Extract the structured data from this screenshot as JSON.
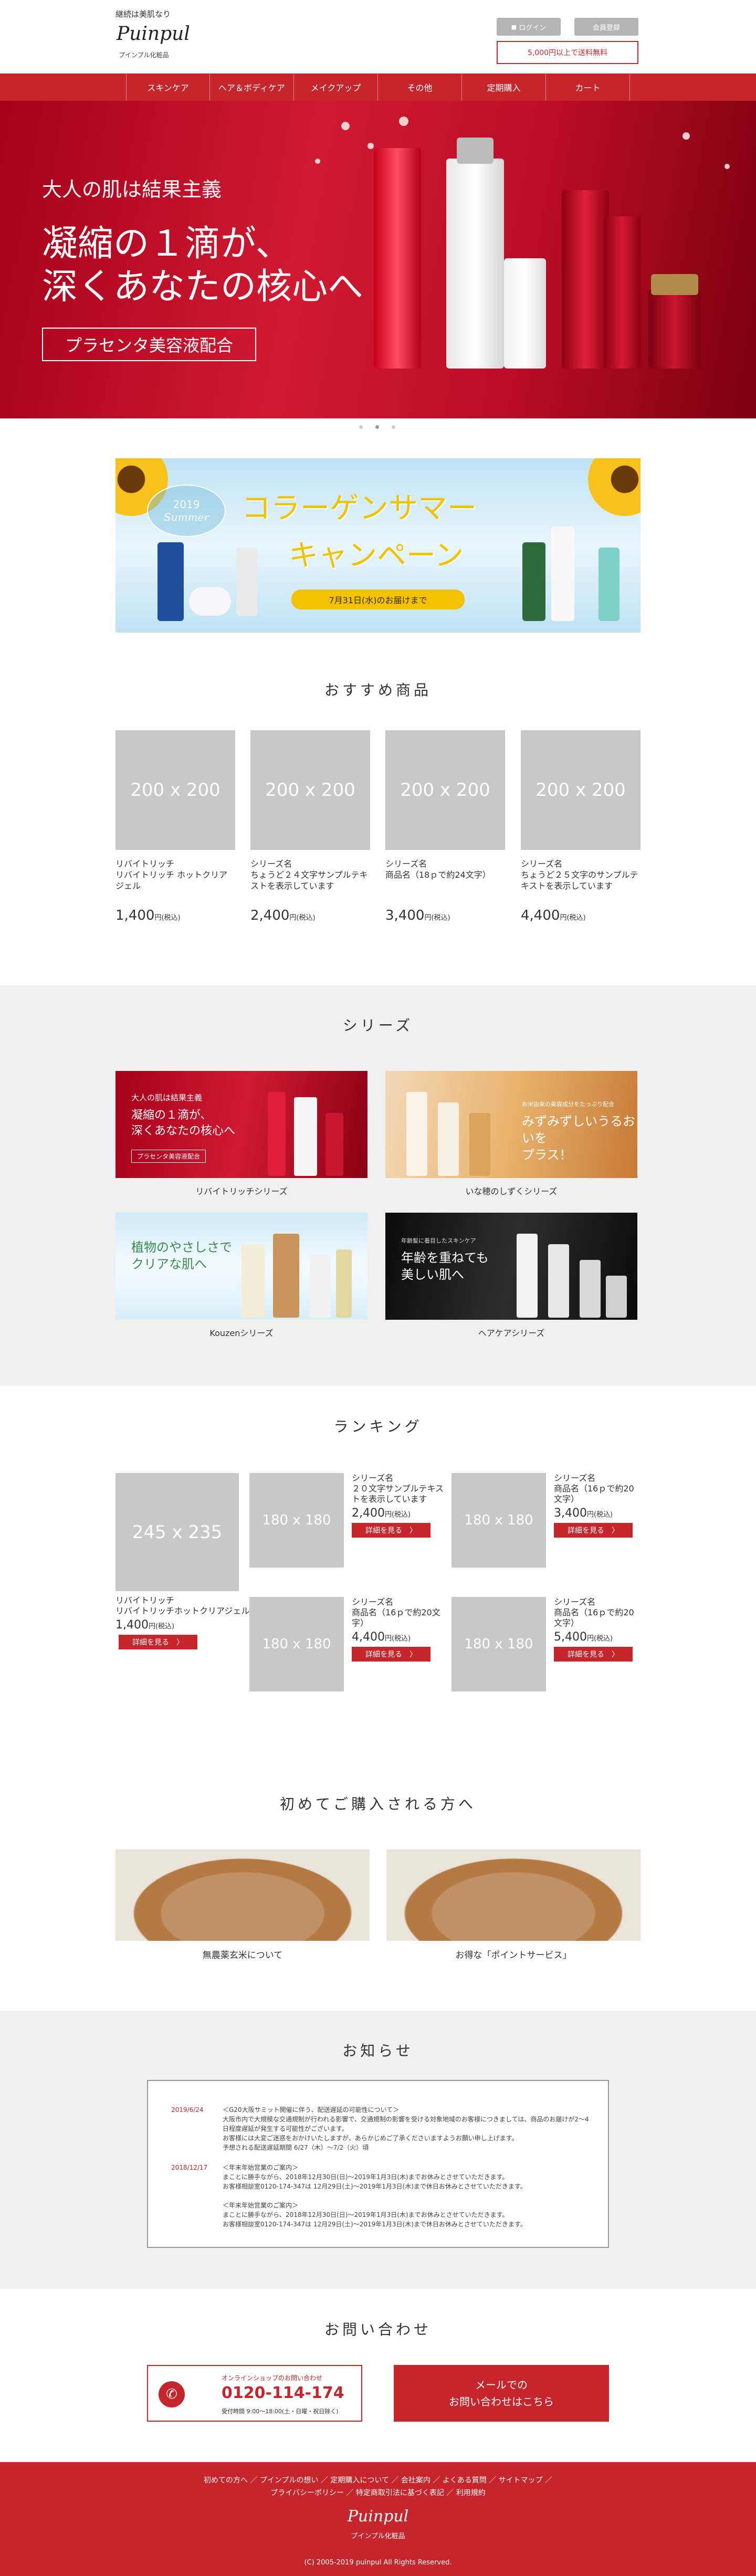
{
  "header": {
    "tagline": "継続は美肌なり",
    "logo": "Puinpul",
    "logo_sub": "プインプル化粧品",
    "login": "ログイン",
    "register": "会員登録",
    "free_shipping": "5,000円以上で送料無料"
  },
  "nav": [
    "スキンケア",
    "ヘア＆ボディケア",
    "メイクアップ",
    "その他",
    "定期購入",
    "カート"
  ],
  "hero": {
    "line1": "大人の肌は結果主義",
    "line2a": "凝縮の１滴が、",
    "line2b": "深くあなたの核心へ",
    "badge": "プラセンタ美容液配合"
  },
  "campaign": {
    "year": "2019",
    "season": "Summer",
    "title1": "コラーゲンサマー",
    "title2": "キャンペーン",
    "deadline": "7月31日(水)のお届けまで"
  },
  "recommended": {
    "title": "おすすめ商品",
    "placeholder": "200 x 200",
    "items": [
      {
        "name": "リバイトリッチ\nリバイトリッチ ホットクリアジェル",
        "price": "1,400",
        "tax": "円(税込)"
      },
      {
        "name": "シリーズ名\nちょうど２４文字サンプルテキストを表示しています",
        "price": "2,400",
        "tax": "円(税込)"
      },
      {
        "name": "シリーズ名\n商品名（18ｐで約24文字）",
        "price": "3,400",
        "tax": "円(税込)"
      },
      {
        "name": "シリーズ名\nちょうど２５文字のサンプルテキストを表示しています",
        "price": "4,400",
        "tax": "円(税込)"
      }
    ]
  },
  "series": {
    "title": "シリーズ",
    "items": [
      {
        "label": "リバイトリッチシリーズ",
        "img_t1": "大人の肌は結果主義",
        "img_t2": "凝縮の１滴が、\n深くあなたの核心へ",
        "img_t3": "プラセンタ美容液配合"
      },
      {
        "label": "いな穂のしずくシリーズ",
        "img_t1": "お米由来の美容成分をたっぷり配合",
        "img_t2": "みずみずしいうるおいを\nプラス！"
      },
      {
        "label": "Kouzenシリーズ",
        "img_t1": "植物のやさしさで\nクリアな肌へ"
      },
      {
        "label": "ヘアケアシリーズ",
        "img_t1": "年齢髪に着目したスキンケア",
        "img_t2": "年齢を重ねても\n美しい肌へ"
      }
    ]
  },
  "ranking": {
    "title": "ランキング",
    "big_placeholder": "245 x 235",
    "placeholder": "180 x 180",
    "more": "詳細を見る　〉",
    "first": {
      "name": "リバイトリッチ\nリバイトリッチホットクリアジェル",
      "price": "1,400",
      "tax": "円(税込)"
    },
    "items": [
      {
        "name": "シリーズ名\n２０文字サンプルテキストを表示しています",
        "price": "2,400",
        "tax": "円(税込)"
      },
      {
        "name": "シリーズ名\n商品名（16ｐで約20文字）",
        "price": "3,400",
        "tax": "円(税込)"
      },
      {
        "name": "シリーズ名\n商品名（16ｐで約20文字）",
        "price": "4,400",
        "tax": "円(税込)"
      },
      {
        "name": "シリーズ名\n商品名（16ｐで約20文字）",
        "price": "5,400",
        "tax": "円(税込)"
      }
    ]
  },
  "first_time": {
    "title": "初めてご購入される方へ",
    "items": [
      "無農薬玄米について",
      "お得な「ポイントサービス」"
    ]
  },
  "news": {
    "title": "お知らせ",
    "items": [
      {
        "date": "2019/6/24",
        "body": "＜G20大阪サミット開催に伴う、配送遅延の可能性について＞\n大阪市内で大規模な交通規制が行われる影響で、交通規制の影響を受ける対象地域のお客様につきましては、商品のお届けが2〜4日程度遅延が発生する可能性がございます。\nお客様には大変ご迷惑をおかけいたしますが、あらかじめご了承くださいますようお願い申し上げます。\n予想される配送遅延期間 6/27（木）〜7/2（火）頃"
      },
      {
        "date": "2018/12/17",
        "body": "＜年末年始営業のご案内＞\nまことに勝手ながら、2018年12月30日(日)〜2019年1月3日(木)までお休みとさせていただきます。\nお客様相談室0120-174-347は 12月29日(土)〜2019年1月3日(木)まで休日お休みとさせていただきます。\n\n＜年末年始営業のご案内＞\nまことに勝手ながら、2018年12月30日(日)〜2019年1月3日(木)までお休みとさせていただきます。\nお客様相談室0120-174-347は 12月29日(土)〜2019年1月3日(木)まで休日お休みとさせていただきます。"
      }
    ]
  },
  "contact": {
    "title": "お問い合わせ",
    "tel_label": "オンラインショップのお問い合わせ",
    "tel": "0120-114-174",
    "hours": "受付時間 9:00〜18:00(土・日曜・祝日除く)",
    "mail_line1": "メールでの",
    "mail_line2": "お問い合わせはこちら"
  },
  "footer": {
    "links1": "初めての方へ ／ プインプルの想い ／ 定期購入について ／ 会社案内 ／ よくある質問 ／ サイトマップ ／",
    "links2": "プライバシーポリシー ／ 特定商取引法に基づく表記 ／ 利用規約",
    "logo": "Puinpul",
    "logo_sub": "プインプル化粧品",
    "copyright": "(C) 2005-2019 puinpul All Rights Reserved."
  },
  "colors": {
    "brand": "#c6262b",
    "gray_button": "#b4b4b4",
    "section_bg": "#f1f0f0"
  }
}
